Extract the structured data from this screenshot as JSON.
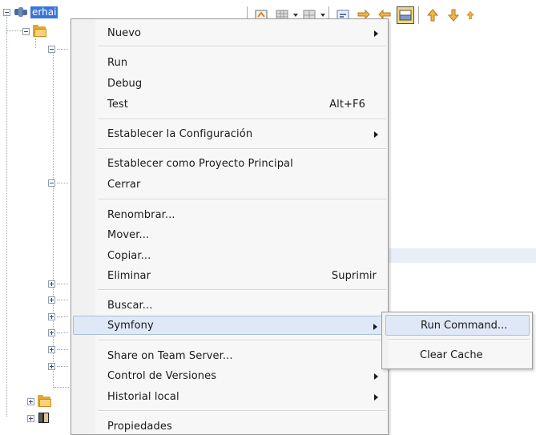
{
  "tree": {
    "project_label": "erhai"
  },
  "toolbar": {
    "icons": [
      "toggle-view-icon",
      "grid-icon",
      "grid-alt-icon",
      "inspect-icon",
      "move-right-icon",
      "move-left-icon",
      "split-panel-icon",
      "arrow-up-icon",
      "arrow-down-icon",
      "arrow-next-icon"
    ]
  },
  "context_menu": {
    "items": [
      {
        "label": "Nuevo",
        "has_submenu": true
      },
      {
        "label": "Run"
      },
      {
        "label": "Debug"
      },
      {
        "label": "Test",
        "shortcut": "Alt+F6"
      },
      {
        "label": "Establecer la Configuración",
        "has_submenu": true
      },
      {
        "label": "Establecer como Proyecto Principal"
      },
      {
        "label": "Cerrar"
      },
      {
        "label": "Renombrar..."
      },
      {
        "label": "Mover..."
      },
      {
        "label": "Copiar..."
      },
      {
        "label": "Eliminar",
        "shortcut": "Suprimir"
      },
      {
        "label": "Buscar..."
      },
      {
        "label": "Symfony",
        "has_submenu": true,
        "highlighted": true
      },
      {
        "label": "Share on Team Server..."
      },
      {
        "label": "Control de Versiones",
        "has_submenu": true
      },
      {
        "label": "Historial local",
        "has_submenu": true
      },
      {
        "label": "Propiedades"
      }
    ]
  },
  "submenu": {
    "items": [
      {
        "label": "Run Command...",
        "highlighted": true
      },
      {
        "label": "Clear Cache"
      }
    ]
  },
  "colors": {
    "selection": "#3875d7",
    "menu_highlight": "#dfe8f6",
    "menu_background": "#f7f7f7",
    "folder": "#e0a832"
  }
}
